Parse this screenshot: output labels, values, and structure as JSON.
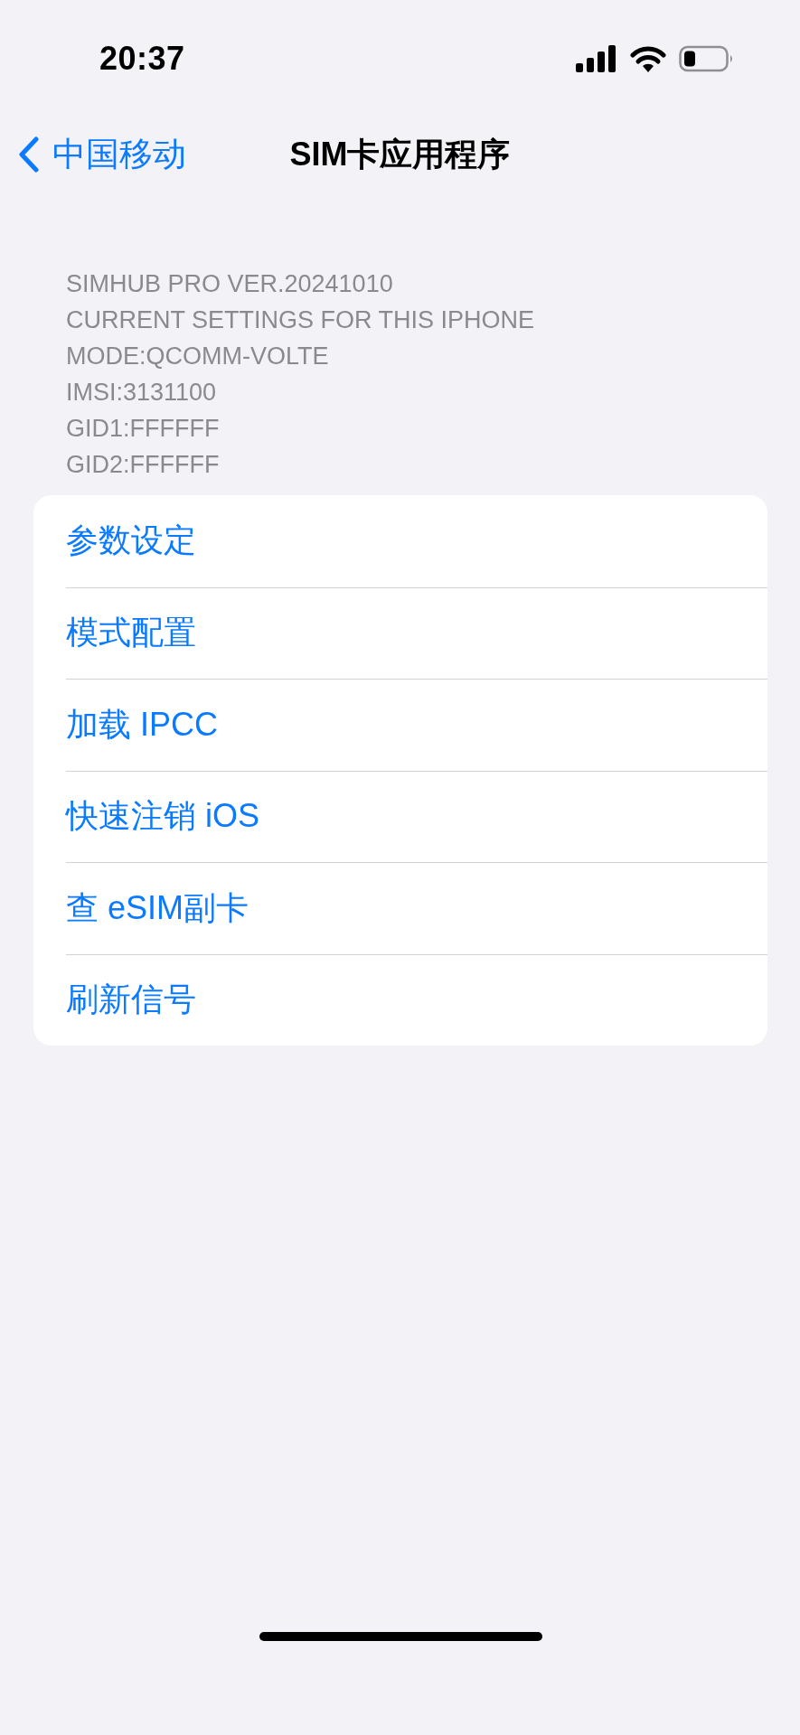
{
  "status_bar": {
    "time": "20:37"
  },
  "nav": {
    "back_label": "中国移动",
    "title": "SIM卡应用程序"
  },
  "info_lines": [
    "SIMHUB PRO VER.20241010",
    "CURRENT SETTINGS FOR THIS IPHONE",
    "MODE:QCOMM-VOLTE",
    "IMSI:3131100",
    "GID1:FFFFFF",
    "GID2:FFFFFF"
  ],
  "menu_items": [
    "参数设定",
    "模式配置",
    "加载 IPCC",
    "快速注销 iOS",
    "查 eSIM副卡",
    "刷新信号"
  ]
}
